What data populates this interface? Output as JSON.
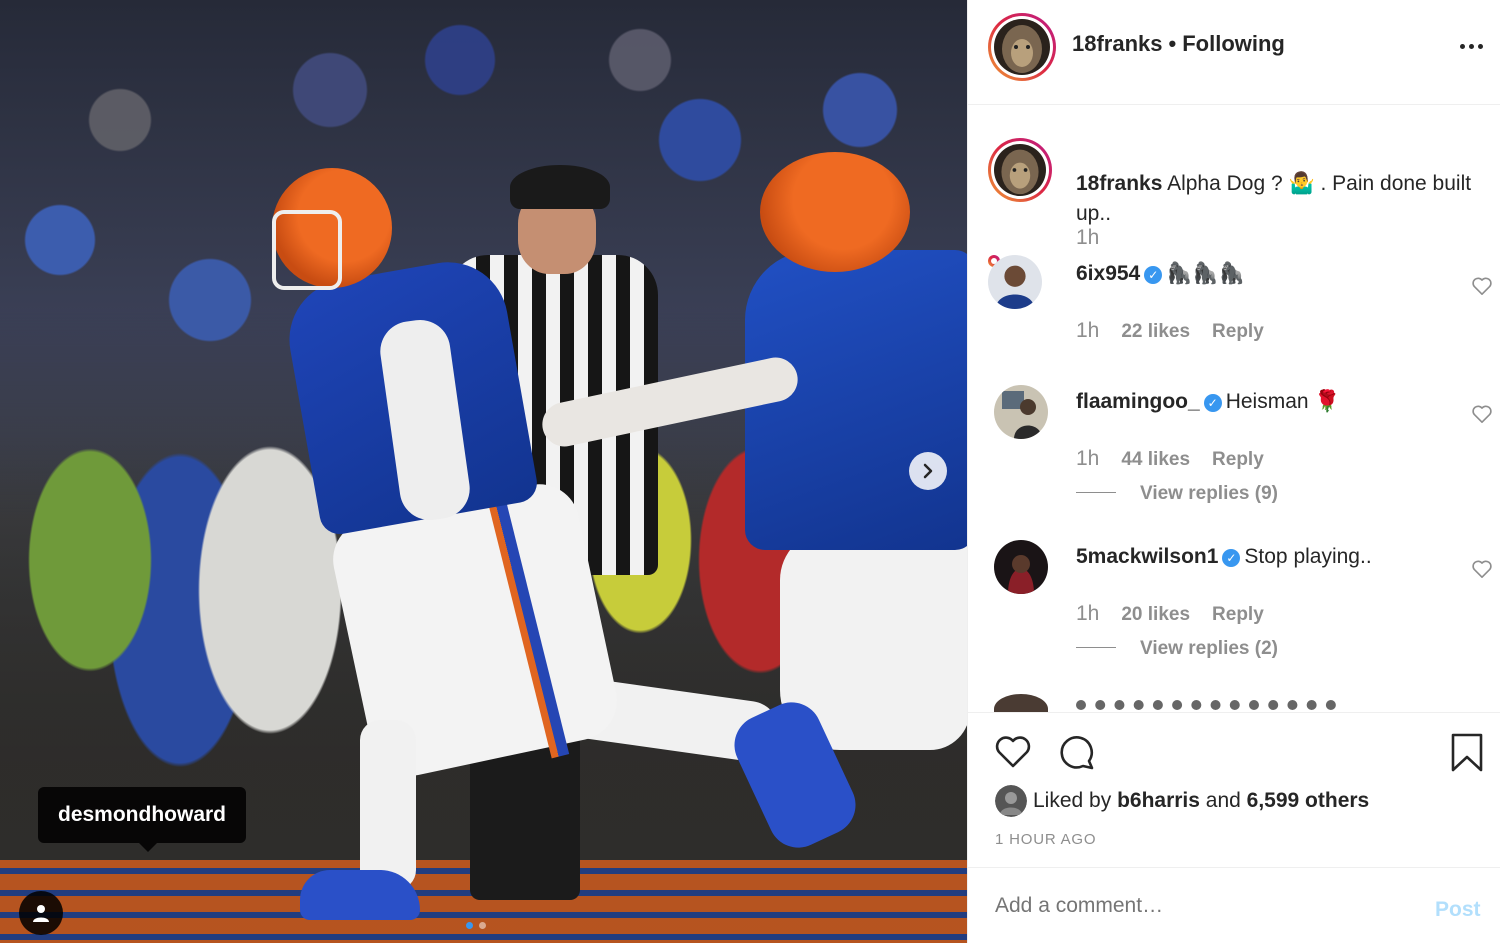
{
  "post": {
    "username": "18franks",
    "separator": "•",
    "follow_status": "Following",
    "tagged_user": "desmondhoward",
    "colors": {
      "accent": "#3897f0",
      "post_disabled": "#b2dffc",
      "muted": "#8e8e8e"
    }
  },
  "caption": {
    "username": "18franks",
    "text": "Alpha Dog ? 🤷‍♂️ . Pain done built up..",
    "time": "1h"
  },
  "comments": [
    {
      "username": "6ix954",
      "verified": true,
      "text": "🦍🦍🦍",
      "time": "1h",
      "likes": "22 likes",
      "reply": "Reply",
      "view_replies": ""
    },
    {
      "username": "flaamingoo_",
      "verified": true,
      "text": "Heisman 🌹",
      "time": "1h",
      "likes": "44 likes",
      "reply": "Reply",
      "view_replies": "View replies (9)"
    },
    {
      "username": "5mackwilson1",
      "verified": true,
      "text": "Stop playing..",
      "time": "1h",
      "likes": "20 likes",
      "reply": "Reply",
      "view_replies": "View replies (2)"
    }
  ],
  "likes": {
    "prefix": "Liked by",
    "user": "b6harris",
    "middle": "and",
    "others": "6,599 others"
  },
  "timestamp": "1 HOUR AGO",
  "add_comment": {
    "placeholder": "Add a comment…",
    "post_label": "Post"
  },
  "icons": {
    "more": "more-options-icon",
    "heart": "heart-icon",
    "comment": "comment-icon",
    "bookmark": "bookmark-icon",
    "next": "chevron-right-icon",
    "user_tag": "user-tag-icon"
  }
}
